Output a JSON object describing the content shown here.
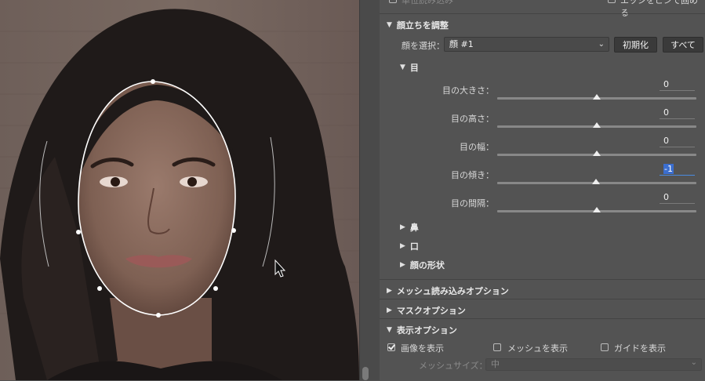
{
  "top_partial": {
    "left_checkbox_label": "単位読み込み",
    "right_checkbox_label": "エッジをピンで固める"
  },
  "face_adjust": {
    "header": "顔立ちを調整",
    "select_face_label": "顔を選択：",
    "select_face_value": "顔 #1",
    "reset_button": "初期化",
    "all_button": "すべて",
    "eyes": {
      "header": "目",
      "sliders": [
        {
          "label": "目の大きさ：",
          "value": "0",
          "fraction": 0.5
        },
        {
          "label": "目の高さ：",
          "value": "0",
          "fraction": 0.5
        },
        {
          "label": "目の幅：",
          "value": "0",
          "fraction": 0.5
        },
        {
          "label": "目の傾き：",
          "value": "-1",
          "fraction": 0.498
        },
        {
          "label": "目の間隔：",
          "value": "0",
          "fraction": 0.5
        }
      ]
    },
    "nose": "鼻",
    "mouth": "口",
    "face_shape": "顔の形状"
  },
  "mesh_load_options": "メッシュ読み込みオプション",
  "mask_options": "マスクオプション",
  "display_options": {
    "header": "表示オプション",
    "show_image": "画像を表示",
    "show_image_checked": true,
    "show_mesh": "メッシュを表示",
    "show_mesh_checked": false,
    "show_guide": "ガイドを表示",
    "show_guide_checked": false,
    "mesh_size_label": "メッシュサイズ：",
    "mesh_size_value": "中"
  },
  "icons": {
    "collapse_expanded": "triangle-down-icon",
    "collapse_closed": "triangle-right-icon",
    "dropdown": "chevron-down-icon",
    "cursor": "mouse-pointer-icon"
  }
}
